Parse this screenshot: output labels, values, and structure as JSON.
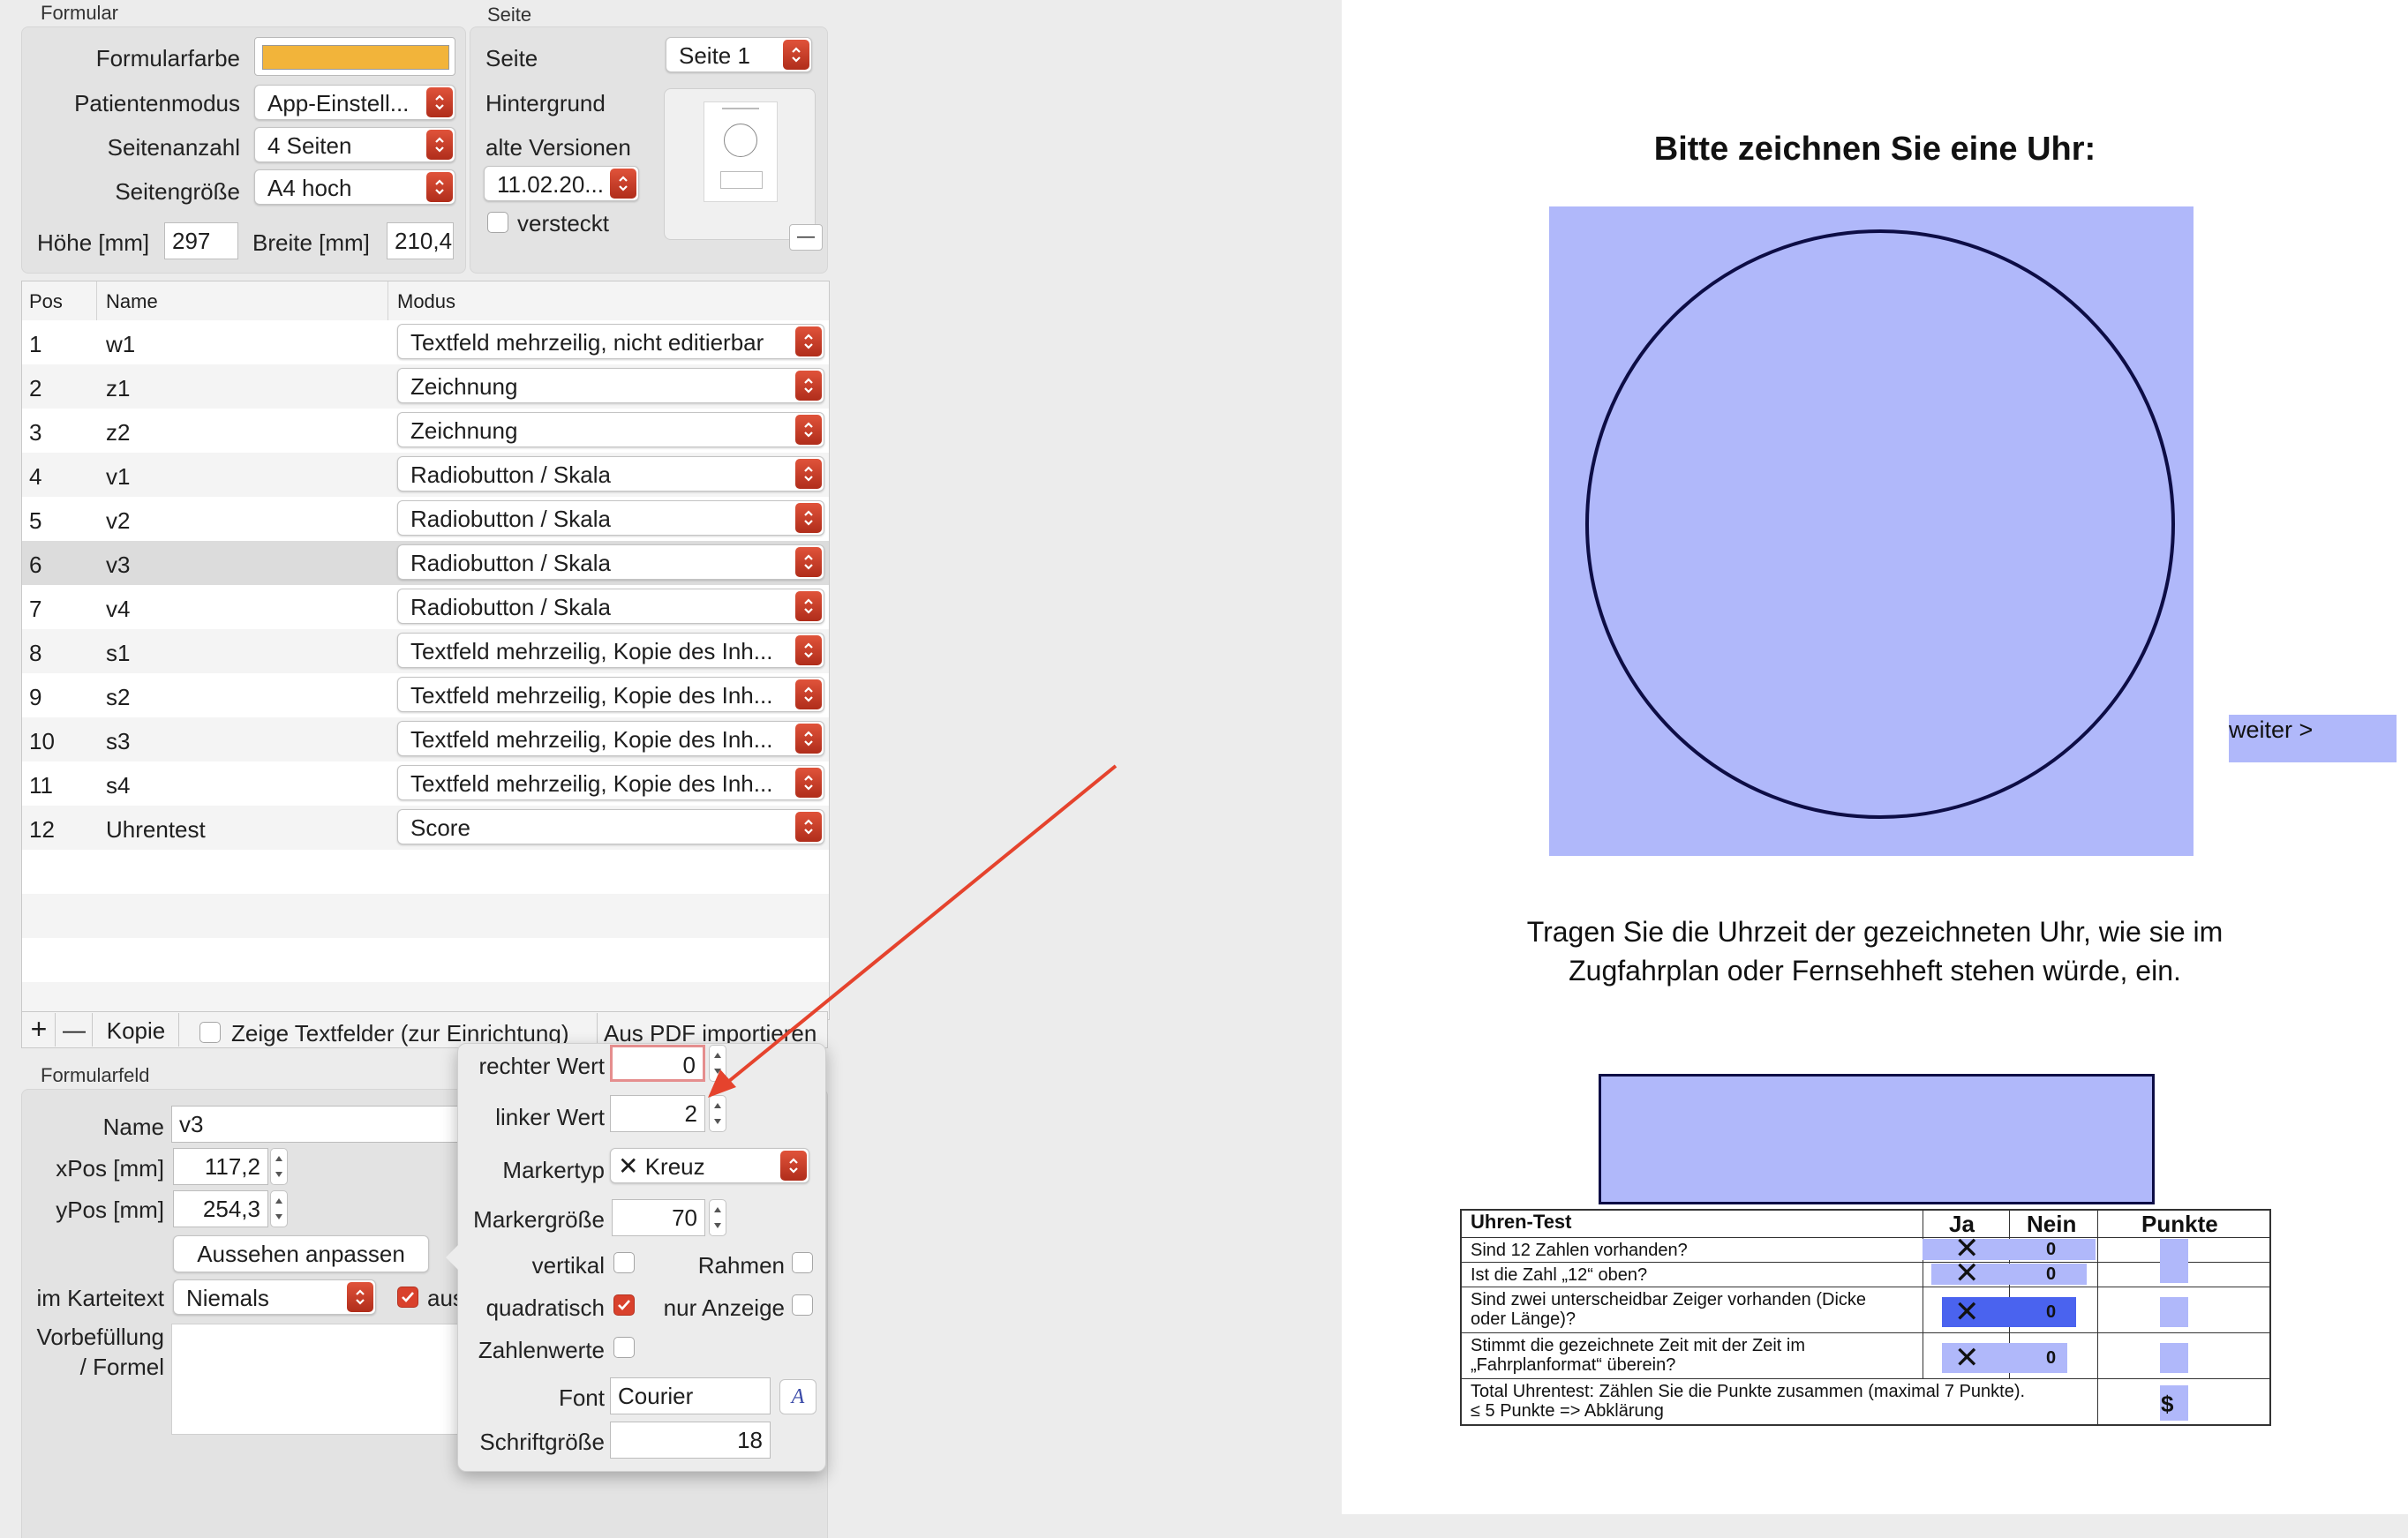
{
  "formular": {
    "section_title": "Formular",
    "farbe_label": "Formularfarbe",
    "farbe_value": "#f2b43a",
    "patientenmodus_label": "Patientenmodus",
    "patientenmodus_value": "App-Einstell...",
    "seitenanzahl_label": "Seitenanzahl",
    "seitenanzahl_value": "4 Seiten",
    "seitengroesse_label": "Seitengröße",
    "seitengroesse_value": "A4 hoch",
    "hoehe_label": "Höhe [mm]",
    "hoehe_value": "297",
    "breite_label": "Breite [mm]",
    "breite_value": "210,4"
  },
  "seite": {
    "section_title": "Seite",
    "seite_label": "Seite",
    "seite_value": "Seite 1",
    "hintergrund_label": "Hintergrund",
    "alte_versionen_label": "alte Versionen",
    "alte_versionen_value": "11.02.20...",
    "versteckt_label": "versteckt",
    "remove_label": "—"
  },
  "table": {
    "columns": [
      "Pos",
      "Name",
      "Modus"
    ],
    "rows": [
      {
        "pos": "1",
        "name": "w1",
        "modus": "Textfeld mehrzeilig, nicht editierbar"
      },
      {
        "pos": "2",
        "name": "z1",
        "modus": "Zeichnung"
      },
      {
        "pos": "3",
        "name": "z2",
        "modus": "Zeichnung"
      },
      {
        "pos": "4",
        "name": "v1",
        "modus": "Radiobutton / Skala"
      },
      {
        "pos": "5",
        "name": "v2",
        "modus": "Radiobutton / Skala"
      },
      {
        "pos": "6",
        "name": "v3",
        "modus": "Radiobutton / Skala"
      },
      {
        "pos": "7",
        "name": "v4",
        "modus": "Radiobutton / Skala"
      },
      {
        "pos": "8",
        "name": "s1",
        "modus": "Textfeld mehrzeilig, Kopie des Inh..."
      },
      {
        "pos": "9",
        "name": "s2",
        "modus": "Textfeld mehrzeilig, Kopie des Inh..."
      },
      {
        "pos": "10",
        "name": "s3",
        "modus": "Textfeld mehrzeilig, Kopie des Inh..."
      },
      {
        "pos": "11",
        "name": "s4",
        "modus": "Textfeld mehrzeilig, Kopie des Inh..."
      },
      {
        "pos": "12",
        "name": "Uhrentest",
        "modus": "Score"
      }
    ],
    "selected_pos": "6"
  },
  "toolbar": {
    "add": "+",
    "remove": "—",
    "kopie": "Kopie",
    "zeige_textfelder": "Zeige Textfelder (zur Einrichtung)",
    "aus_pdf": "Aus PDF importieren"
  },
  "formularfeld": {
    "section_title": "Formularfeld",
    "name_label": "Name",
    "name_value": "v3",
    "xpos_label": "xPos [mm]",
    "xpos_value": "117,2",
    "ypos_label": "yPos [mm]",
    "ypos_value": "254,3",
    "aussehen_button": "Aussehen anpassen",
    "karteitext_label": "im Karteitext",
    "karteitext_value": "Niemals",
    "aus_label": "aus",
    "vorbefuellung_label_1": "Vorbefüllung",
    "vorbefuellung_label_2": "/ Formel"
  },
  "popover": {
    "rechter_wert_label": "rechter Wert",
    "rechter_wert_value": "0",
    "linker_wert_label": "linker Wert",
    "linker_wert_value": "2",
    "markertyp_label": "Markertyp",
    "markertyp_value": "Kreuz",
    "markergroesse_label": "Markergröße",
    "markergroesse_value": "70",
    "vertikal_label": "vertikal",
    "rahmen_label": "Rahmen",
    "quadratisch_label": "quadratisch",
    "nur_anzeige_label": "nur Anzeige",
    "zahlenwerte_label": "Zahlenwerte",
    "font_label": "Font",
    "font_value": "Courier",
    "font_button": "A",
    "schriftgroesse_label": "Schriftgröße",
    "schriftgroesse_value": "18"
  },
  "document": {
    "title": "Bitte zeichnen Sie eine Uhr:",
    "weiter": "weiter >",
    "instruction_line1": "Tragen Sie die Uhrzeit der gezeichneten Uhr, wie sie im",
    "instruction_line2": "Zugfahrplan oder Fernsehheft stehen würde, ein.",
    "field_color": "#b0b8fa",
    "selected_field_color": "#4a63ef",
    "table": {
      "header_title": "Uhren-Test",
      "col_ja": "Ja",
      "col_nein": "Nein",
      "col_punkte": "Punkte",
      "q1": "Sind 12 Zahlen vorhanden?",
      "q2": "Ist die Zahl „12“ oben?",
      "q3_line1": "Sind zwei unterscheidbar Zeiger vorhanden (Dicke",
      "q3_line2": "oder Länge)?",
      "q4_line1": "Stimmt die gezeichnete Zeit mit der Zeit im",
      "q4_line2": "„Fahrplanformat“ überein?",
      "total_line1": "Total Uhrentest: Zählen Sie die Punkte zusammen (maximal 7 Punkte).",
      "total_line2": "≤ 5 Punkte => Abklärung",
      "zero": "0",
      "dollar": "$"
    }
  },
  "colors": {
    "accent_red": "#d9412c",
    "arrow": "#e5432d"
  }
}
